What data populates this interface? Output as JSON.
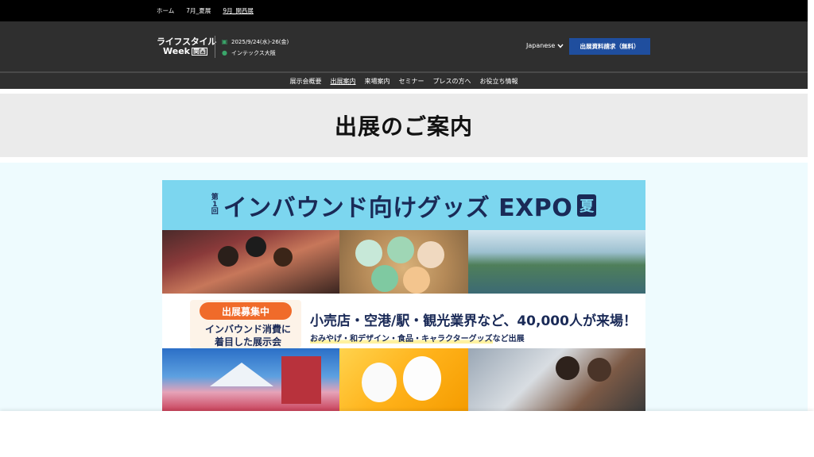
{
  "top_links": [
    {
      "label": "ホーム"
    },
    {
      "label": "7月_夏展"
    },
    {
      "label": "9月_関西展"
    }
  ],
  "logo": {
    "line1": "ライフスタイル",
    "line2": "Week",
    "badge": "関西"
  },
  "event": {
    "date": "2025/9/24(水)-26(金)",
    "venue": "インテックス大阪",
    "calendar_icon": "calendar-icon",
    "pin_icon": "map-pin-icon"
  },
  "language": {
    "label": "Japanese",
    "icon": "chevron-down-icon"
  },
  "cta": {
    "label": "出展資料請求（無料）",
    "color": "#1f4e9e"
  },
  "nav": [
    {
      "label": "展示会概要"
    },
    {
      "label": "出展案内"
    },
    {
      "label": "来場案内"
    },
    {
      "label": "セミナー"
    },
    {
      "label": "プレスの方へ"
    },
    {
      "label": "お役立ち情報"
    }
  ],
  "page_title": "出展のご案内",
  "banner": {
    "edition_top": "第",
    "edition_num": "1",
    "edition_bottom": "回",
    "title": "インバウンド向けグッズ EXPO",
    "season": "夏",
    "recruit": "出展募集中",
    "focus_line1": "インバウンド消費に",
    "focus_line2": "着目した展示会",
    "headline": "小売店・空港/駅・観光業界など、40,000人が来場！",
    "subline_highlight": "おみやげ・和デザイン・食品・キャラクターグッズ",
    "subline_tail": "など出展",
    "accent_color": "#f06b2a",
    "head_color": "#7cd6ef",
    "text_color": "#1a2a57"
  }
}
